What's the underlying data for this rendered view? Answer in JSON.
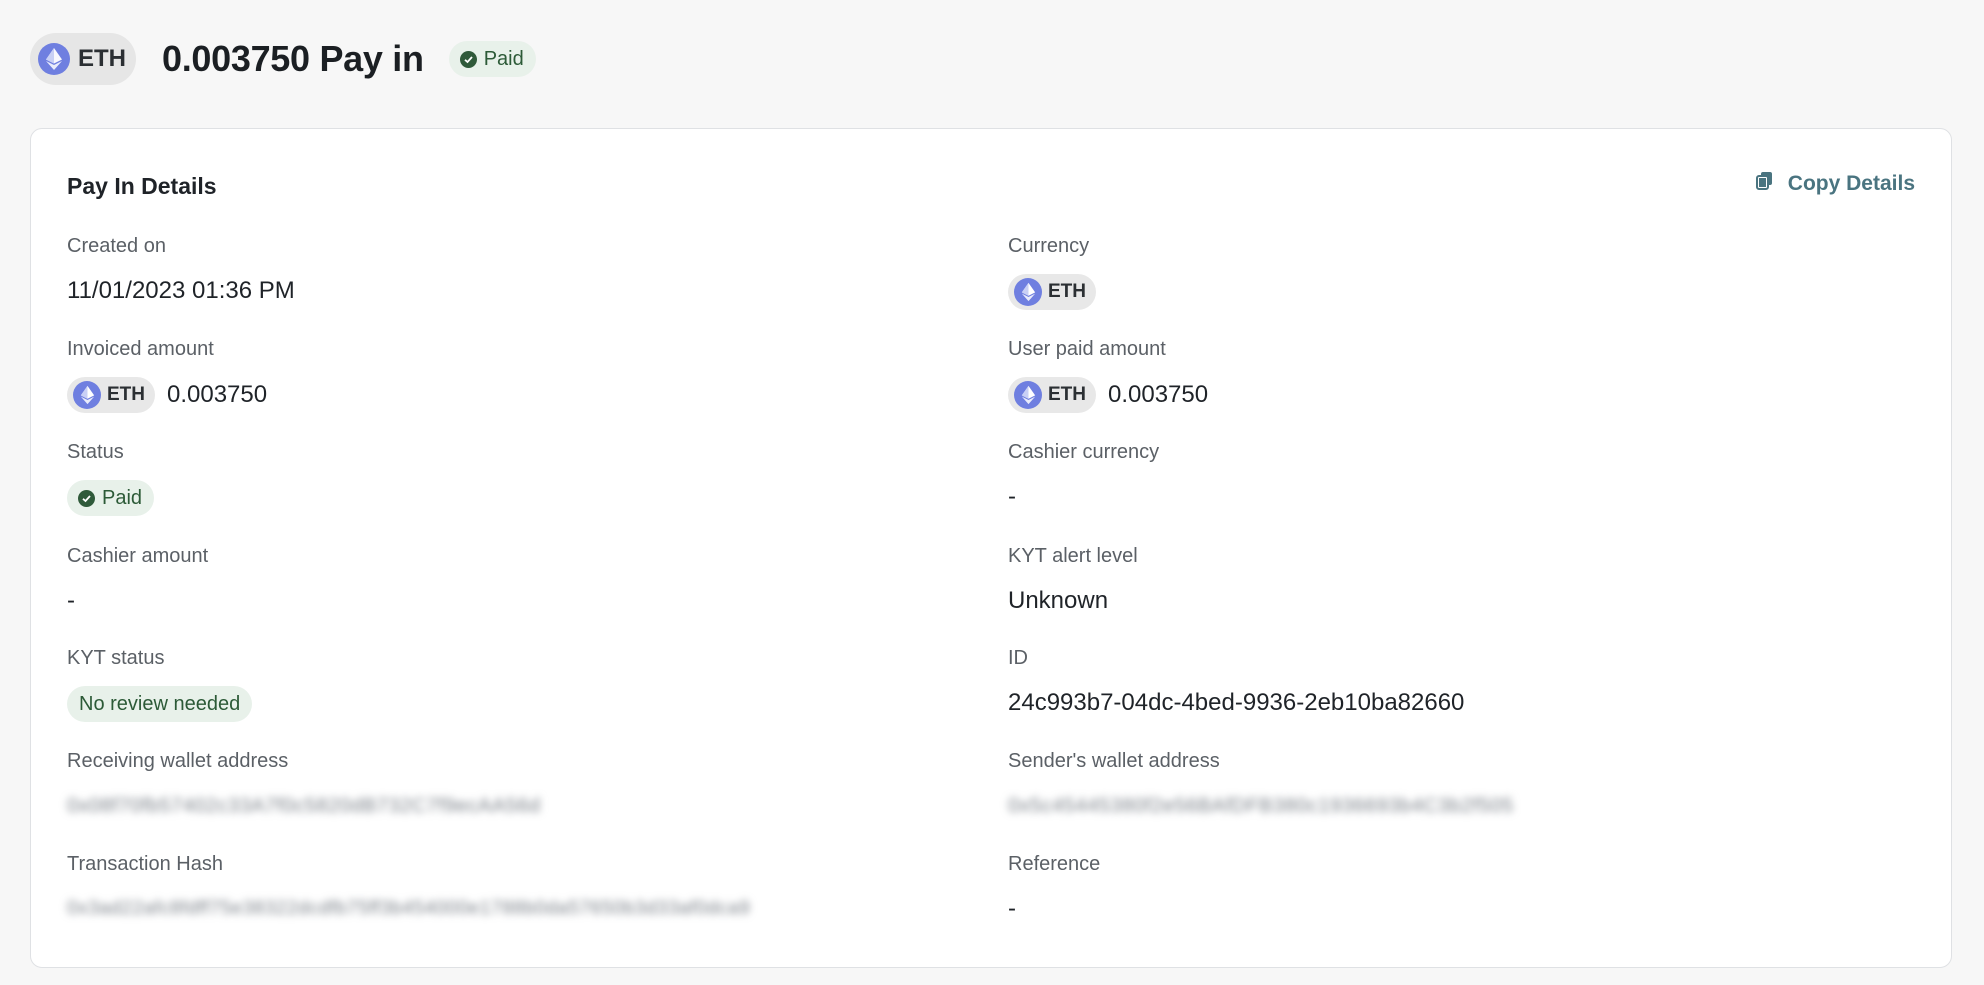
{
  "header": {
    "currency": "ETH",
    "title": "0.003750 Pay in",
    "status": "Paid"
  },
  "card": {
    "title": "Pay In Details",
    "copy_label": "Copy Details"
  },
  "fields": {
    "created_on": {
      "label": "Created on",
      "value": "11/01/2023 01:36 PM"
    },
    "currency": {
      "label": "Currency",
      "value": "ETH"
    },
    "invoiced_amount": {
      "label": "Invoiced amount",
      "currency": "ETH",
      "value": "0.003750"
    },
    "user_paid_amount": {
      "label": "User paid amount",
      "currency": "ETH",
      "value": "0.003750"
    },
    "status": {
      "label": "Status",
      "value": "Paid"
    },
    "cashier_currency": {
      "label": "Cashier currency",
      "value": "-"
    },
    "cashier_amount": {
      "label": "Cashier amount",
      "value": "-"
    },
    "kyt_alert_level": {
      "label": "KYT alert level",
      "value": "Unknown"
    },
    "kyt_status": {
      "label": "KYT status",
      "value": "No review needed"
    },
    "id": {
      "label": "ID",
      "value": "24c993b7-04dc-4bed-9936-2eb10ba82660"
    },
    "receiving_wallet": {
      "label": "Receiving wallet address",
      "value": "0x08f70fb57402c33A7f0c5820dB732C7f9ecAA56d"
    },
    "sender_wallet": {
      "label": "Sender's wallet address",
      "value": "0x5c45445380f2e56BAfDFB380c1936693b4C3b2f505"
    },
    "transaction_hash": {
      "label": "Transaction Hash",
      "value": "0x3ad22afc8fdff75e38322dcdfb75ff3b454000e1788b0da57650b3d33af0dca9"
    },
    "reference": {
      "label": "Reference",
      "value": "-"
    }
  },
  "colors": {
    "eth_icon": "#6f7fe0",
    "paid_bg": "#e8f1ea",
    "paid_text": "#2c5a37",
    "accent": "#4a7480"
  }
}
